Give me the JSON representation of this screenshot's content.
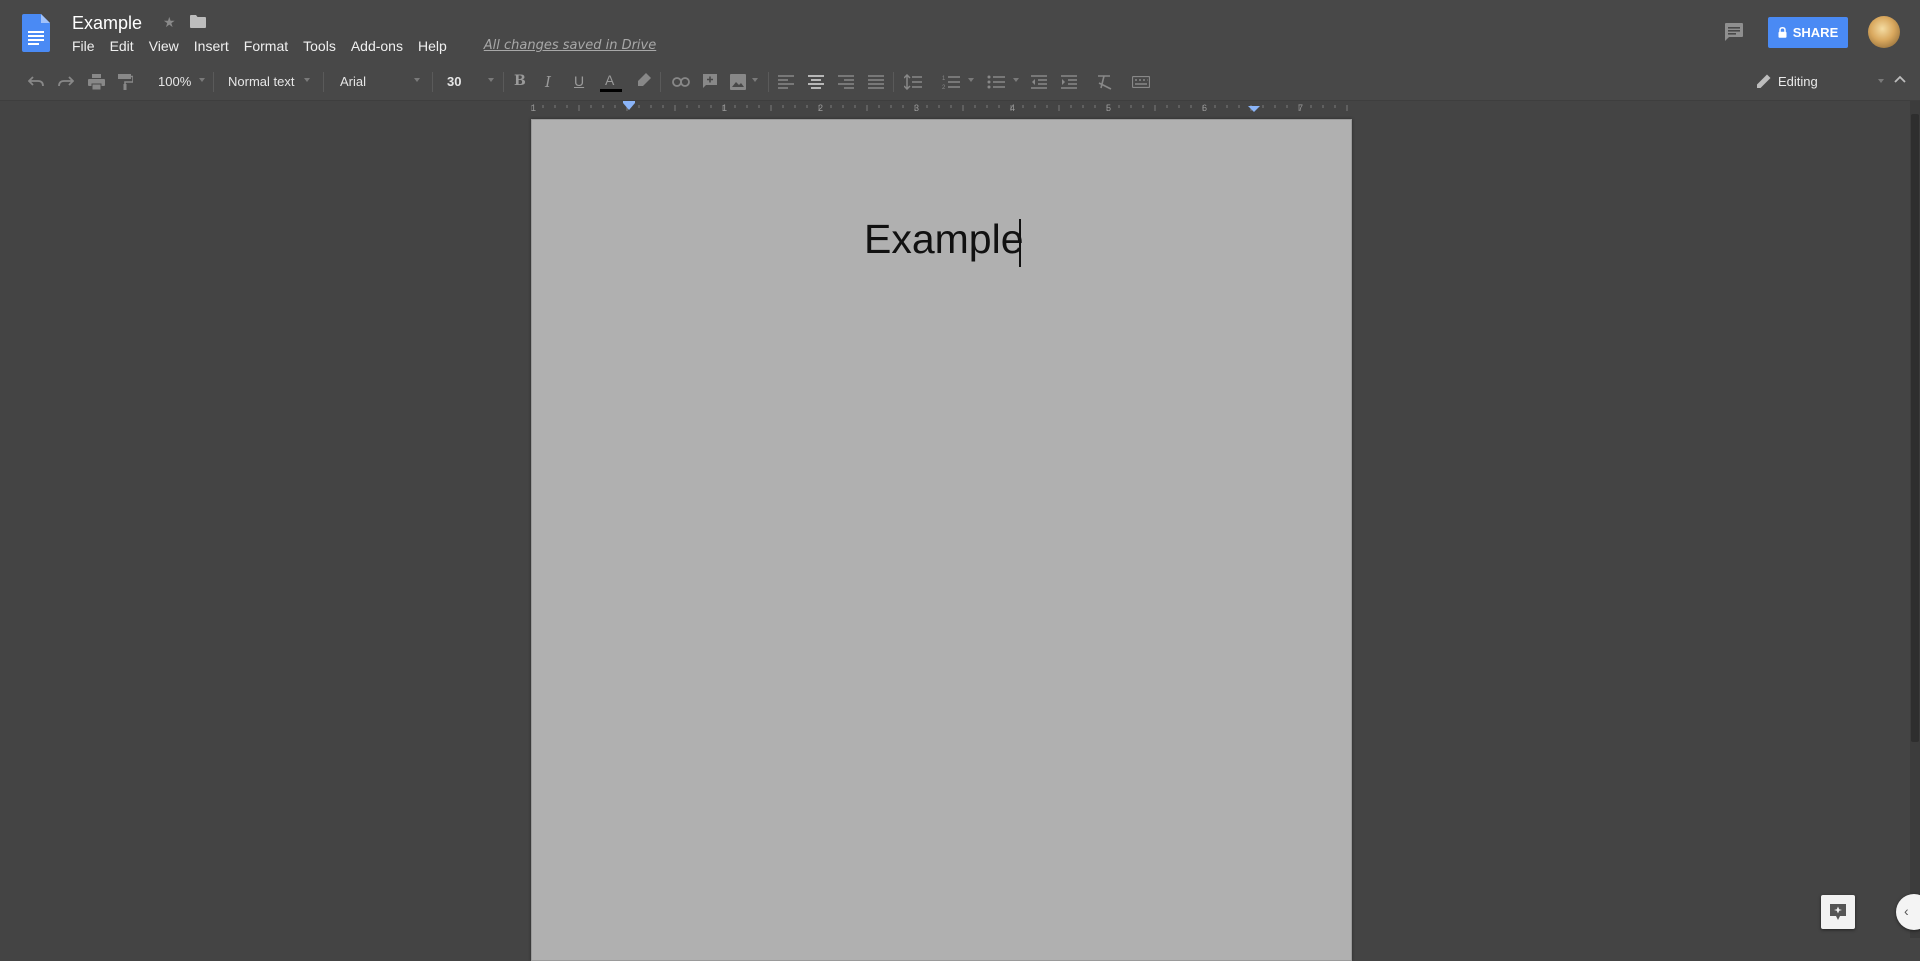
{
  "header": {
    "doc_title": "Example",
    "menu": [
      "File",
      "Edit",
      "View",
      "Insert",
      "Format",
      "Tools",
      "Add-ons",
      "Help"
    ],
    "save_status": "All changes saved in Drive",
    "share_label": "SHARE"
  },
  "toolbar": {
    "zoom": "100%",
    "paragraph_style": "Normal text",
    "font": "Arial",
    "font_size": "30",
    "mode": "Editing"
  },
  "ruler": {
    "numbers": [
      "1",
      "1",
      "2",
      "3",
      "4",
      "5",
      "6",
      "7"
    ]
  },
  "document": {
    "heading": "Example"
  },
  "colors": {
    "share_button": "#4a8af4",
    "page_background": "#b0b0b0",
    "app_background": "#444444"
  },
  "icons": [
    "docs-logo-icon",
    "star-icon",
    "folder-icon",
    "comments-icon",
    "lock-icon",
    "undo-icon",
    "redo-icon",
    "print-icon",
    "paint-format-icon",
    "bold-icon",
    "italic-icon",
    "underline-icon",
    "text-color-icon",
    "highlight-icon",
    "link-icon",
    "add-comment-icon",
    "image-icon",
    "align-left-icon",
    "align-center-icon",
    "align-right-icon",
    "justify-icon",
    "line-spacing-icon",
    "numbered-list-icon",
    "bulleted-list-icon",
    "decrease-indent-icon",
    "increase-indent-icon",
    "clear-formatting-icon",
    "input-tools-icon",
    "pencil-icon",
    "collapse-icon",
    "explore-icon",
    "chevron-left-icon"
  ]
}
